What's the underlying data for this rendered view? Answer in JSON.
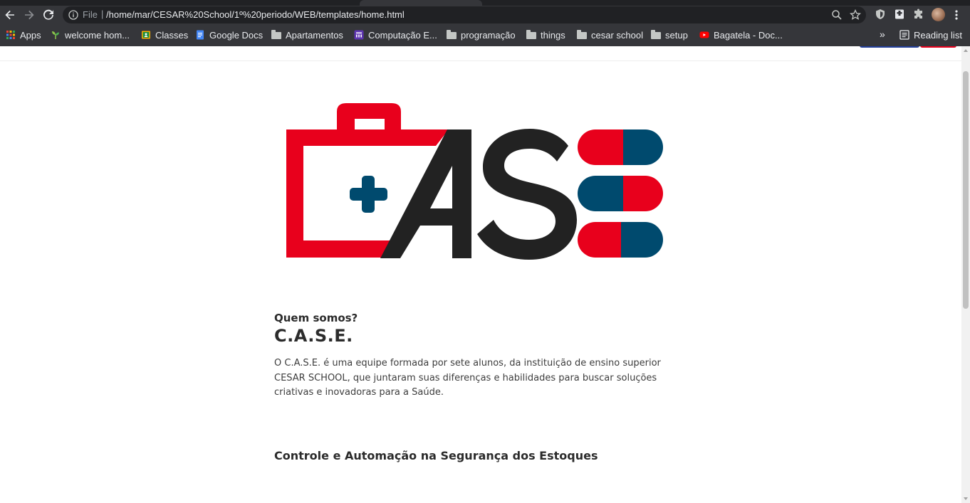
{
  "browser": {
    "url_scheme_label": "File",
    "url": "/home/mar/CESAR%20School/1º%20periodo/WEB/templates/home.html",
    "bookmarks": [
      {
        "label": "Apps",
        "icon": "apps-grid-icon"
      },
      {
        "label": "welcome hom...",
        "icon": "plant-icon"
      },
      {
        "label": "Classes",
        "icon": "classroom-icon"
      },
      {
        "label": "Google Docs",
        "icon": "docs-icon"
      },
      {
        "label": "Apartamentos",
        "icon": "folder-icon"
      },
      {
        "label": "Computação E...",
        "icon": "site-icon"
      },
      {
        "label": "programação",
        "icon": "folder-icon"
      },
      {
        "label": "things",
        "icon": "folder-icon"
      },
      {
        "label": "cesar school",
        "icon": "folder-icon"
      },
      {
        "label": "setup",
        "icon": "folder-icon"
      },
      {
        "label": "Bagatela - Doc...",
        "icon": "youtube-icon"
      }
    ],
    "overflow_label": "»",
    "reading_list_label": "Reading list"
  },
  "page": {
    "eyebrow": "Quem somos?",
    "title": "C.A.S.E.",
    "description": "O C.A.S.E. é uma equipe formada por sete alunos, da instituição de ensino superior CESAR SCHOOL, que juntaram suas diferenças e habilidades para buscar soluções criativas e inovadoras para a Saúde.",
    "section_title": "Controle e Automação na Segurança dos Estoques"
  },
  "colors": {
    "brand_red": "#e8001c",
    "brand_blue": "#004a6e",
    "brand_dark": "#222222"
  }
}
